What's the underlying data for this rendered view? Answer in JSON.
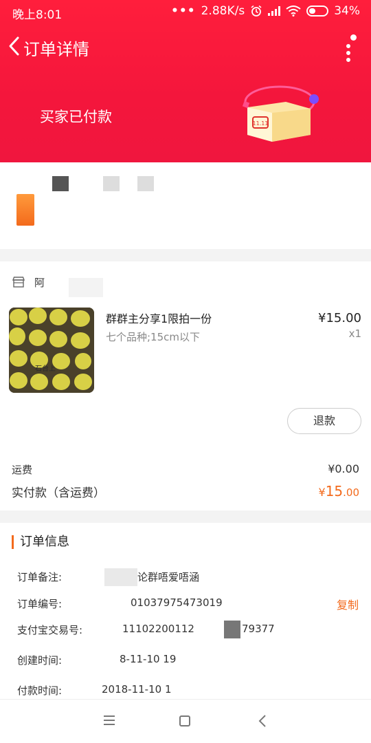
{
  "status_bar": {
    "time": "晚上8:01",
    "dots": "•••",
    "net_speed": "2.88K/s",
    "battery": "34%",
    "icons": [
      "alarm-icon",
      "signal-icon",
      "wifi-icon",
      "battery-icon"
    ]
  },
  "nav": {
    "title": "订单详情",
    "back_icon": "chevron-left-icon",
    "more_icon": "more-vertical-icon"
  },
  "banner": {
    "status_text": "买家已付款",
    "illustration": "package-box-icon",
    "box_label": "11.11"
  },
  "shop": {
    "icon": "store-icon",
    "name": "阿"
  },
  "product": {
    "title": "群群主分享1限拍一份",
    "spec": "七个品种;15cm以下",
    "price": "¥15.00",
    "qty": "x1",
    "image_caption": "石台上",
    "refund_label": "退款"
  },
  "summary": {
    "shipping_label": "运费",
    "shipping_value": "¥0.00",
    "paid_label": "实付款（含运费）",
    "paid_symbol": "¥",
    "paid_int": "15",
    "paid_dec": ".00"
  },
  "order_info": {
    "title": "订单信息",
    "note_label": "订单备注:",
    "note_value": "论群唔爱唔涵",
    "number_label": "订单编号:",
    "number_value": "01037975473019",
    "copy_label": "复制",
    "alipay_label": "支付宝交易号:",
    "alipay_value_a": "11102200112",
    "alipay_value_b": "79377",
    "created_label": "创建时间:",
    "created_value": "8-11-10 19",
    "paid_label": "付款时间:",
    "paid_value": "2018-11-10 1"
  },
  "bottom_nav": {
    "menu_icon": "menu-icon",
    "home_icon": "square-home-icon",
    "back_icon": "back-arrow-icon"
  },
  "colors": {
    "header_red": "#f4163c",
    "accent_orange": "#f36a1c",
    "background": "#f3f3f3"
  }
}
